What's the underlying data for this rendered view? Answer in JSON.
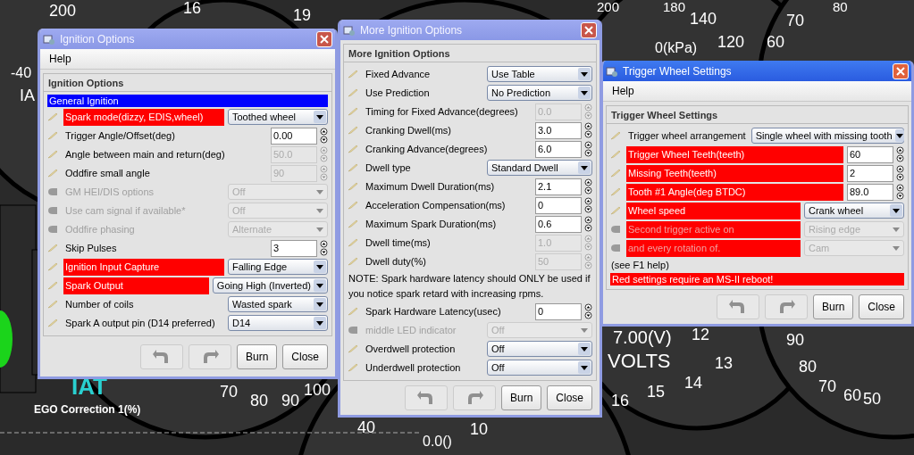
{
  "dashboard": {
    "labels": [
      {
        "text": "200"
      },
      {
        "text": "16"
      },
      {
        "text": "19"
      },
      {
        "text": "200"
      },
      {
        "text": "180"
      },
      {
        "text": "140"
      },
      {
        "text": "120"
      },
      {
        "text": "0(kPa)"
      },
      {
        "text": "70"
      },
      {
        "text": "60"
      },
      {
        "text": "80"
      },
      {
        "text": "-40"
      },
      {
        "text": "IA"
      },
      {
        "text": "7.00(V)"
      },
      {
        "text": "VOLTS"
      },
      {
        "text": "12"
      },
      {
        "text": "13"
      },
      {
        "text": "14"
      },
      {
        "text": "15"
      },
      {
        "text": "16"
      },
      {
        "text": "90"
      },
      {
        "text": "80"
      },
      {
        "text": "70"
      },
      {
        "text": "60"
      },
      {
        "text": "50"
      },
      {
        "text": "IAT"
      },
      {
        "text": "EGO Correction 1(%)"
      },
      {
        "text": "70"
      },
      {
        "text": "80"
      },
      {
        "text": "90"
      },
      {
        "text": "100"
      },
      {
        "text": "40"
      },
      {
        "text": "10"
      },
      {
        "text": "0.0()"
      }
    ]
  },
  "windows": [
    {
      "title": "Ignition Options",
      "active": false,
      "menu": [
        "Help"
      ],
      "panel_title": "Ignition Options",
      "rows": [
        {
          "kind": "header",
          "label": "General Ignition"
        },
        {
          "kind": "combo",
          "label": "Spark mode(dizzy, EDIS,wheel)",
          "value": "Toothed wheel",
          "highlighted": true,
          "disabled": false
        },
        {
          "kind": "spin",
          "label": "Trigger Angle/Offset(deg)",
          "value": "0.00",
          "highlighted": false,
          "disabled": false
        },
        {
          "kind": "spin",
          "label": "Angle between main and return(deg)",
          "value": "50.0",
          "highlighted": false,
          "disabled": true,
          "label_disabled": false
        },
        {
          "kind": "spin",
          "label": "Oddfire small angle",
          "value": "90",
          "highlighted": false,
          "disabled": true,
          "label_disabled": false
        },
        {
          "kind": "combo",
          "label": "GM HEI/DIS options",
          "value": "Off",
          "highlighted": false,
          "disabled": true
        },
        {
          "kind": "combo",
          "label": "Use cam signal if available*",
          "value": "Off",
          "highlighted": false,
          "disabled": true
        },
        {
          "kind": "combo",
          "label": "Oddfire phasing",
          "value": "Alternate",
          "highlighted": false,
          "disabled": true
        },
        {
          "kind": "spin",
          "label": "Skip Pulses",
          "value": "3",
          "highlighted": false,
          "disabled": false
        },
        {
          "kind": "combo",
          "label": "Ignition Input Capture",
          "value": "Falling Edge",
          "highlighted": true,
          "disabled": false
        },
        {
          "kind": "combo",
          "label": "Spark Output",
          "value": "Going High (Inverted)",
          "highlighted": true,
          "disabled": false
        },
        {
          "kind": "combo",
          "label": "Number of coils",
          "value": "Wasted spark",
          "highlighted": false,
          "disabled": false
        },
        {
          "kind": "combo",
          "label": "Spark A output pin (D14 preferred)",
          "value": "D14",
          "highlighted": false,
          "disabled": false
        }
      ],
      "buttons": [
        {
          "kind": "undo",
          "disabled": true
        },
        {
          "kind": "redo",
          "disabled": true
        },
        {
          "kind": "text",
          "label": "Burn",
          "disabled": false
        },
        {
          "kind": "text",
          "label": "Close",
          "disabled": false
        }
      ]
    },
    {
      "title": "More Ignition Options",
      "active": false,
      "panel_title": "More Ignition Options",
      "rows": [
        {
          "kind": "combo",
          "label": "Fixed Advance",
          "value": "Use Table",
          "highlighted": false,
          "disabled": false
        },
        {
          "kind": "combo",
          "label": "Use Prediction",
          "value": "No Prediction",
          "highlighted": false,
          "disabled": false
        },
        {
          "kind": "spin",
          "label": "Timing for Fixed Advance(degrees)",
          "value": "0.0",
          "highlighted": false,
          "disabled": true,
          "label_disabled": false
        },
        {
          "kind": "spin",
          "label": "Cranking Dwell(ms)",
          "value": "3.0",
          "highlighted": false,
          "disabled": false
        },
        {
          "kind": "spin",
          "label": "Cranking Advance(degrees)",
          "value": "6.0",
          "highlighted": false,
          "disabled": false
        },
        {
          "kind": "combo",
          "label": "Dwell type",
          "value": "Standard Dwell",
          "highlighted": false,
          "disabled": false
        },
        {
          "kind": "spin",
          "label": "Maximum Dwell Duration(ms)",
          "value": "2.1",
          "highlighted": false,
          "disabled": false
        },
        {
          "kind": "spin",
          "label": "Acceleration Compensation(ms)",
          "value": "0",
          "highlighted": false,
          "disabled": false
        },
        {
          "kind": "spin",
          "label": "Maximum Spark Duration(ms)",
          "value": "0.6",
          "highlighted": false,
          "disabled": false
        },
        {
          "kind": "spin",
          "label": "Dwell time(ms)",
          "value": "1.0",
          "highlighted": false,
          "disabled": true,
          "label_disabled": false
        },
        {
          "kind": "spin",
          "label": "Dwell duty(%)",
          "value": "50",
          "highlighted": false,
          "disabled": true,
          "label_disabled": false
        },
        {
          "kind": "note",
          "label": "NOTE: Spark hardware latency should ONLY be used if you notice spark retard with increasing rpms."
        },
        {
          "kind": "spin",
          "label": "Spark Hardware Latency(usec)",
          "value": "0",
          "highlighted": false,
          "disabled": false
        },
        {
          "kind": "combo",
          "label": "middle LED indicator",
          "value": "Off",
          "highlighted": false,
          "disabled": true
        },
        {
          "kind": "combo",
          "label": "Overdwell protection",
          "value": "Off",
          "highlighted": false,
          "disabled": false
        },
        {
          "kind": "combo",
          "label": "Underdwell protection",
          "value": "Off",
          "highlighted": false,
          "disabled": false
        }
      ],
      "buttons": [
        {
          "kind": "undo",
          "disabled": true
        },
        {
          "kind": "redo",
          "disabled": true
        },
        {
          "kind": "text",
          "label": "Burn",
          "disabled": false
        },
        {
          "kind": "text",
          "label": "Close",
          "disabled": false
        }
      ]
    },
    {
      "title": "Trigger Wheel Settings",
      "active": true,
      "menu": [
        "Help"
      ],
      "panel_title": "Trigger Wheel Settings",
      "rows": [
        {
          "kind": "combo",
          "label": "Trigger wheel arrangement",
          "value": "Single wheel with missing tooth",
          "highlighted": false,
          "disabled": false
        },
        {
          "kind": "spin",
          "label": "Trigger Wheel Teeth(teeth)",
          "value": "60",
          "highlighted": true,
          "disabled": false
        },
        {
          "kind": "spin",
          "label": "Missing Teeth(teeth)",
          "value": "2",
          "highlighted": true,
          "disabled": false
        },
        {
          "kind": "spin",
          "label": "Tooth #1 Angle(deg BTDC)",
          "value": "89.0",
          "highlighted": true,
          "disabled": false
        },
        {
          "kind": "combo",
          "label": "Wheel speed",
          "value": "Crank wheel",
          "highlighted": true,
          "disabled": false
        },
        {
          "kind": "combo",
          "label": "Second trigger active on",
          "value": "Rising edge",
          "highlighted": true,
          "disabled": true
        },
        {
          "kind": "combo",
          "label": "and every rotation of.",
          "value": "Cam",
          "highlighted": true,
          "disabled": true
        },
        {
          "kind": "plain",
          "label": "(see F1 help)"
        },
        {
          "kind": "warning",
          "label": "Red settings require an MS-II reboot!"
        }
      ],
      "buttons": [
        {
          "kind": "undo",
          "disabled": true
        },
        {
          "kind": "redo",
          "disabled": true
        },
        {
          "kind": "text",
          "label": "Burn",
          "disabled": false
        },
        {
          "kind": "text",
          "label": "Close",
          "disabled": false
        }
      ]
    }
  ]
}
